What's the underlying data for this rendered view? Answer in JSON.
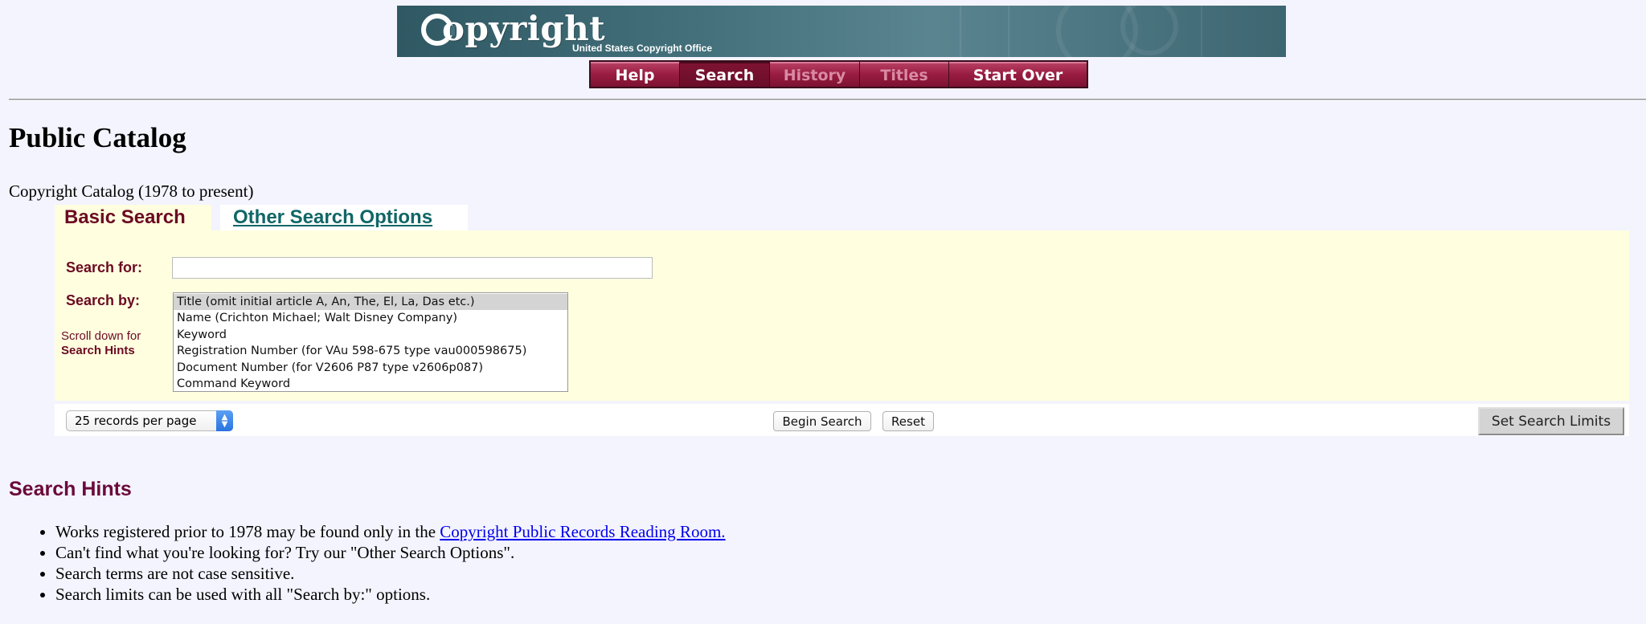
{
  "banner": {
    "logo_text": "opyright",
    "logo_subtitle": "United States Copyright Office"
  },
  "nav": {
    "items": [
      {
        "label": "Help",
        "state": "normal"
      },
      {
        "label": "Search",
        "state": "active"
      },
      {
        "label": "History",
        "state": "disabled"
      },
      {
        "label": "Titles",
        "state": "disabled"
      },
      {
        "label": "Start Over",
        "state": "normal"
      }
    ]
  },
  "page": {
    "title": "Public Catalog",
    "catalog": "Copyright Catalog (1978 to present)"
  },
  "tabs": {
    "basic": "Basic Search",
    "other": "Other Search Options"
  },
  "form": {
    "search_for_label": "Search for:",
    "search_for_value": "",
    "search_by_label": "Search by:",
    "hint_line1": "Scroll down for",
    "hint_line2": "Search Hints",
    "search_by_options": [
      "Title (omit initial article A, An, The, El, La, Das etc.)",
      "Name (Crichton Michael; Walt Disney Company)",
      "Keyword",
      "Registration Number (for VAu 598-675 type vau000598675)",
      "Document Number (for V2606 P87 type v2606p087)",
      "Command Keyword"
    ],
    "selected_index": 0,
    "records_per_page": "25 records per page",
    "begin_search": "Begin Search",
    "reset": "Reset",
    "set_limits": "Set Search Limits"
  },
  "hints": {
    "title": "Search Hints",
    "item1_text": "Works registered prior to 1978 may be found only in the ",
    "item1_link": "Copyright Public Records Reading Room.",
    "item2": "Can't find what you're looking for? Try our \"Other Search Options\".",
    "item3": "Search terms are not case sensitive.",
    "item4": "Search limits can be used with all \"Search by:\" options."
  },
  "colors": {
    "nav_maroon": "#9a1d42",
    "label_maroon": "#6b0a22",
    "panel_yellow": "#ffffe0",
    "tab_link_teal": "#116666",
    "page_bg": "#f4f4fe"
  }
}
